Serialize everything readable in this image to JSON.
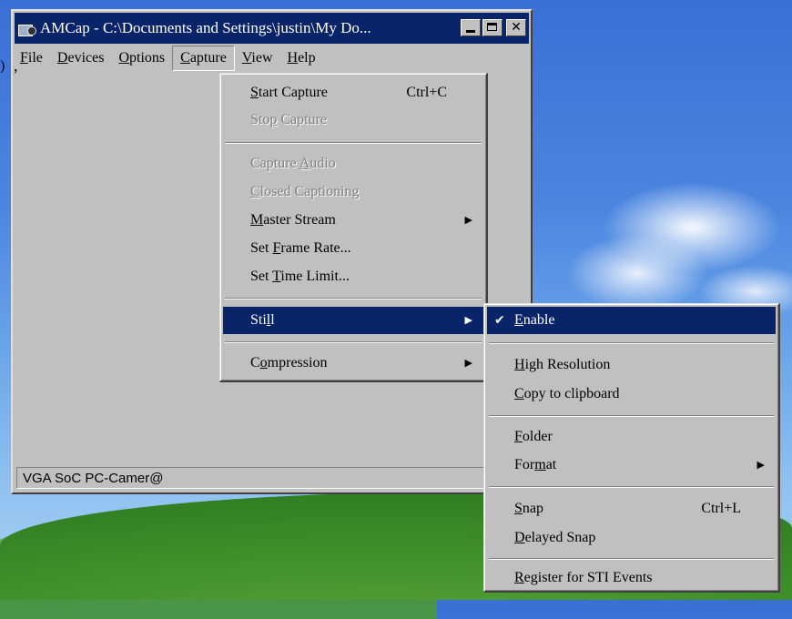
{
  "window": {
    "title": "AMCap - C:\\Documents and Settings\\justin\\My Do...",
    "status_text": "VGA SoC PC-Camer@"
  },
  "menubar": {
    "file": {
      "pre": "",
      "key": "F",
      "post": "ile"
    },
    "devices": {
      "pre": "",
      "key": "D",
      "post": "evices"
    },
    "options": {
      "pre": "",
      "key": "O",
      "post": "ptions"
    },
    "capture": {
      "pre": "",
      "key": "C",
      "post": "apture"
    },
    "view": {
      "pre": "",
      "key": "V",
      "post": "iew"
    },
    "help": {
      "pre": "",
      "key": "H",
      "post": "elp"
    }
  },
  "capture_menu": {
    "start_capture": {
      "pre": "",
      "key": "S",
      "post": "tart Capture",
      "shortcut": "Ctrl+C"
    },
    "stop_capture": {
      "pre": "Sto",
      "key": "p",
      "post": " Capture"
    },
    "capture_audio": {
      "pre": "Capture ",
      "key": "A",
      "post": "udio"
    },
    "closed_captioning": {
      "pre": "",
      "key": "C",
      "post": "losed Captioning"
    },
    "master_stream": {
      "pre": "",
      "key": "M",
      "post": "aster Stream"
    },
    "set_frame_rate": {
      "pre": "Set ",
      "key": "F",
      "post": "rame Rate..."
    },
    "set_time_limit": {
      "pre": "Set ",
      "key": "T",
      "post": "ime Limit..."
    },
    "still": {
      "pre": "Sti",
      "key": "l",
      "post": "l"
    },
    "compression": {
      "pre": "C",
      "key": "o",
      "post": "mpression"
    }
  },
  "still_menu": {
    "enable": {
      "pre": "",
      "key": "E",
      "post": "nable",
      "checked": true
    },
    "high_resolution": {
      "pre": "",
      "key": "H",
      "post": "igh Resolution"
    },
    "copy_to_clipboard": {
      "pre": "",
      "key": "C",
      "post": "opy to clipboard"
    },
    "folder": {
      "pre": "",
      "key": "F",
      "post": "older"
    },
    "format": {
      "pre": "For",
      "key": "m",
      "post": "at"
    },
    "snap": {
      "pre": "",
      "key": "S",
      "post": "nap",
      "shortcut": "Ctrl+L"
    },
    "delayed_snap": {
      "pre": "",
      "key": "D",
      "post": "elayed Snap"
    },
    "register_sti": {
      "pre": "",
      "key": "R",
      "post": "egister for STI Events"
    }
  },
  "desktop": {
    "left_fragment": ")",
    "comma": ","
  },
  "colors": {
    "title_bar": "#0a246a",
    "highlight": "#0a246a",
    "face": "#c0c0c0"
  }
}
